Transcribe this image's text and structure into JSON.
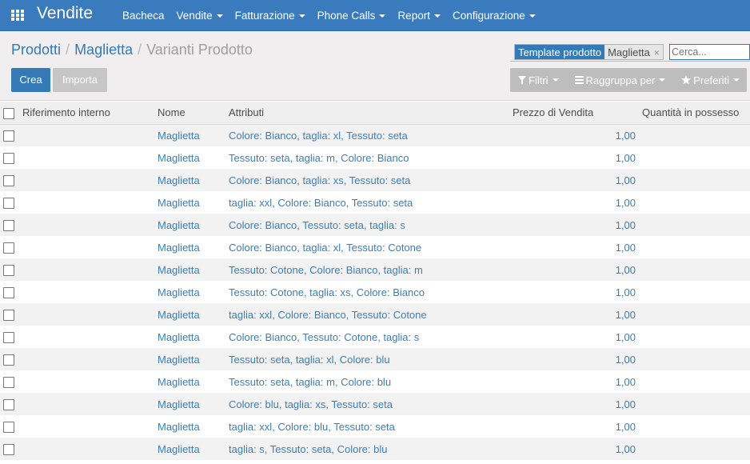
{
  "navbar": {
    "app_title": "Vendite",
    "menu": [
      {
        "label": "Bacheca",
        "dropdown": false
      },
      {
        "label": "Vendite",
        "dropdown": true
      },
      {
        "label": "Fatturazione",
        "dropdown": true
      },
      {
        "label": "Phone Calls",
        "dropdown": true
      },
      {
        "label": "Report",
        "dropdown": true
      },
      {
        "label": "Configurazione",
        "dropdown": true
      }
    ]
  },
  "breadcrumb": {
    "items": [
      "Prodotti",
      "Maglietta"
    ],
    "separator": "/",
    "current": "Varianti Prodotto"
  },
  "search": {
    "facet_label": "Template prodotto",
    "facet_value": "Maglietta",
    "facet_remove": "×",
    "placeholder": "Cerca..."
  },
  "buttons": {
    "create": "Crea",
    "import": "Importa"
  },
  "search_options": {
    "filters": "Filtri",
    "group_by": "Raggruppa per",
    "favorites": "Preferiti"
  },
  "table": {
    "columns": [
      "Riferimento interno",
      "Nome",
      "Attributi",
      "Prezzo di Vendita",
      "Quantità in possesso"
    ],
    "rows": [
      {
        "ref": "",
        "name": "Maglietta",
        "attributes": "Colore: Bianco, taglia: xl, Tessuto: seta",
        "price": "1,00",
        "qty": ""
      },
      {
        "ref": "",
        "name": "Maglietta",
        "attributes": "Tessuto: seta, taglia: m, Colore: Bianco",
        "price": "1,00",
        "qty": ""
      },
      {
        "ref": "",
        "name": "Maglietta",
        "attributes": "Colore: Bianco, taglia: xs, Tessuto: seta",
        "price": "1,00",
        "qty": ""
      },
      {
        "ref": "",
        "name": "Maglietta",
        "attributes": "taglia: xxl, Colore: Bianco, Tessuto: seta",
        "price": "1,00",
        "qty": ""
      },
      {
        "ref": "",
        "name": "Maglietta",
        "attributes": "Colore: Bianco, Tessuto: seta, taglia: s",
        "price": "1,00",
        "qty": ""
      },
      {
        "ref": "",
        "name": "Maglietta",
        "attributes": "Colore: Bianco, taglia: xl, Tessuto: Cotone",
        "price": "1,00",
        "qty": ""
      },
      {
        "ref": "",
        "name": "Maglietta",
        "attributes": "Tessuto: Cotone, Colore: Bianco, taglia: m",
        "price": "1,00",
        "qty": ""
      },
      {
        "ref": "",
        "name": "Maglietta",
        "attributes": "Tessuto: Cotone, taglia: xs, Colore: Bianco",
        "price": "1,00",
        "qty": ""
      },
      {
        "ref": "",
        "name": "Maglietta",
        "attributes": "taglia: xxl, Colore: Bianco, Tessuto: Cotone",
        "price": "1,00",
        "qty": ""
      },
      {
        "ref": "",
        "name": "Maglietta",
        "attributes": "Colore: Bianco, Tessuto: Cotone, taglia: s",
        "price": "1,00",
        "qty": ""
      },
      {
        "ref": "",
        "name": "Maglietta",
        "attributes": "Tessuto: seta, taglia: xl, Colore: blu",
        "price": "1,00",
        "qty": ""
      },
      {
        "ref": "",
        "name": "Maglietta",
        "attributes": "Tessuto: seta, taglia: m, Colore: blu",
        "price": "1,00",
        "qty": ""
      },
      {
        "ref": "",
        "name": "Maglietta",
        "attributes": "Colore: blu, taglia: xs, Tessuto: seta",
        "price": "1,00",
        "qty": ""
      },
      {
        "ref": "",
        "name": "Maglietta",
        "attributes": "taglia: xxl, Colore: blu, Tessuto: seta",
        "price": "1,00",
        "qty": ""
      },
      {
        "ref": "",
        "name": "Maglietta",
        "attributes": "taglia: s, Tessuto: seta, Colore: blu",
        "price": "1,00",
        "qty": ""
      }
    ]
  },
  "colors": {
    "navbar": "#3a7bbd",
    "primary": "#337ab7",
    "link": "#3a7fb9",
    "control_panel": "#f0eeee"
  },
  "icons": {
    "apps": "apps-grid-icon",
    "filter": "filter-icon",
    "group_by": "bars-icon",
    "favorites": "star-icon",
    "facet_remove": "close-icon"
  }
}
